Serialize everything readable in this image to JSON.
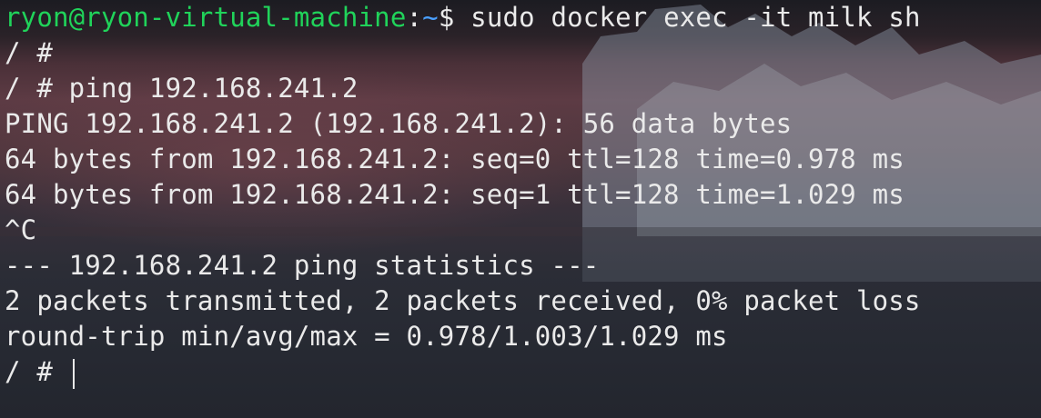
{
  "terminal": {
    "prompt_user_host": "ryon@ryon-virtual-machine",
    "prompt_colon": ":",
    "prompt_path": "~",
    "prompt_dollar": "$ ",
    "first_command": "sudo docker exec -it milk sh",
    "lines": [
      "/ #",
      "/ # ping 192.168.241.2",
      "PING 192.168.241.2 (192.168.241.2): 56 data bytes",
      "64 bytes from 192.168.241.2: seq=0 ttl=128 time=0.978 ms",
      "64 bytes from 192.168.241.2: seq=1 ttl=128 time=1.029 ms",
      "^C",
      "--- 192.168.241.2 ping statistics ---",
      "2 packets transmitted, 2 packets received, 0% packet loss",
      "round-trip min/avg/max = 0.978/1.003/1.029 ms"
    ],
    "current_prompt": "/ # ",
    "colors": {
      "user_host": "#20d35a",
      "path": "#4aa0ff",
      "text": "#eaeaea"
    }
  }
}
